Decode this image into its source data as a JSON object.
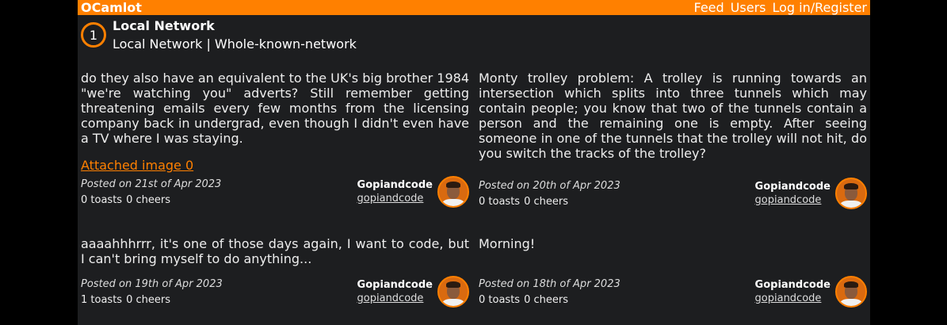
{
  "nav": {
    "brand": "OCamlot",
    "links": [
      "Feed",
      "Users",
      "Log in/Register"
    ]
  },
  "header": {
    "badge": "1",
    "title": "Local Network",
    "sub_local": "Local Network",
    "sub_sep": " | ",
    "sub_whole": "Whole-known-network"
  },
  "posts": [
    {
      "body": "do they also have an equivalent to the UK's big brother 1984 \"we're watching you\" adverts? Still remember getting threatening emails every few months from the licensing company back in undergrad, even though I didn't even have a TV where I was staying.",
      "attachment": "Attached image 0",
      "posted": "Posted on 21st of Apr 2023",
      "toasts": "0 toasts",
      "cheers": "0 cheers",
      "author_name": "Gopiandcode",
      "author_handle": "gopiandcode"
    },
    {
      "body": "Monty trolley problem: A trolley is running towards an intersection which splits into three tunnels which may contain people; you know that two of the tunnels contain a person and the remaining one is empty. After seeing someone in one of the tunnels that the trolley will not hit, do you switch the tracks of the trolley?",
      "posted": "Posted on 20th of Apr 2023",
      "toasts": "0 toasts",
      "cheers": "0 cheers",
      "author_name": "Gopiandcode",
      "author_handle": "gopiandcode"
    },
    {
      "body": "aaaahhhrrr, it's one of those days again, I want to code, but I can't bring myself to do anything...",
      "posted": "Posted on 19th of Apr 2023",
      "toasts": "1 toasts",
      "cheers": "0 cheers",
      "author_name": "Gopiandcode",
      "author_handle": "gopiandcode"
    },
    {
      "body": "Morning!",
      "posted": "Posted on 18th of Apr 2023",
      "toasts": "0 toasts",
      "cheers": "0 cheers",
      "author_name": "Gopiandcode",
      "author_handle": "gopiandcode"
    }
  ],
  "colors": {
    "accent": "#ff8000",
    "panel": "#1d1e20",
    "background": "#000000"
  }
}
